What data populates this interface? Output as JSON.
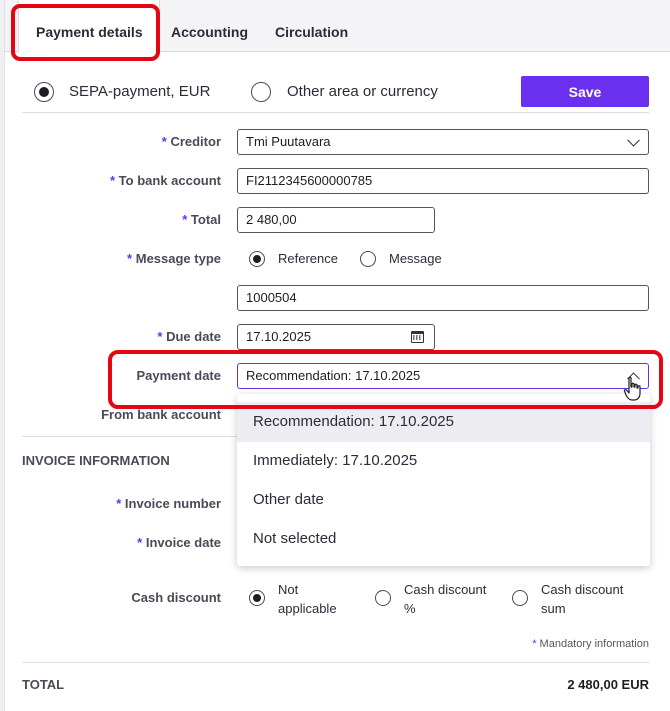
{
  "tabs": [
    {
      "label": "Payment details",
      "active": true
    },
    {
      "label": "Accounting",
      "active": false
    },
    {
      "label": "Circulation",
      "active": false
    }
  ],
  "payment_type": {
    "options": [
      "SEPA-payment, EUR",
      "Other area or currency"
    ],
    "selected": "SEPA-payment, EUR"
  },
  "save_label": "Save",
  "required_marker": "*",
  "form": {
    "creditor": {
      "label": "Creditor",
      "value": "Tmi Puutavara"
    },
    "to_bank_account": {
      "label": "To bank account",
      "value": "FI2112345600000785"
    },
    "total": {
      "label": "Total",
      "value": "2 480,00"
    },
    "message_type": {
      "label": "Message type",
      "options": [
        "Reference",
        "Message"
      ],
      "selected": "Reference"
    },
    "reference": {
      "value": "1000504"
    },
    "due_date": {
      "label": "Due date",
      "value": "17.10.2025"
    },
    "payment_date": {
      "label": "Payment date",
      "value": "Recommendation: 17.10.2025",
      "options": [
        "Recommendation: 17.10.2025",
        "Immediately: 17.10.2025",
        "Other date",
        "Not selected"
      ],
      "expanded": true
    },
    "from_bank_account": {
      "label": "From bank account"
    }
  },
  "invoice_information": {
    "title": "INVOICE INFORMATION",
    "invoice_number": {
      "label": "Invoice number"
    },
    "invoice_date": {
      "label": "Invoice date"
    },
    "cash_discount": {
      "label": "Cash discount",
      "options": [
        {
          "line1": "Not",
          "line2": "applicable"
        },
        {
          "line1": "Cash discount",
          "line2": "%"
        },
        {
          "line1": "Cash discount",
          "line2": "sum"
        }
      ],
      "selected_index": 0
    }
  },
  "mandatory_note": "Mandatory information",
  "total_row": {
    "label": "TOTAL",
    "value": "2 480,00 EUR"
  },
  "colors": {
    "accent": "#6b2ff0",
    "highlight": "#e30613"
  }
}
